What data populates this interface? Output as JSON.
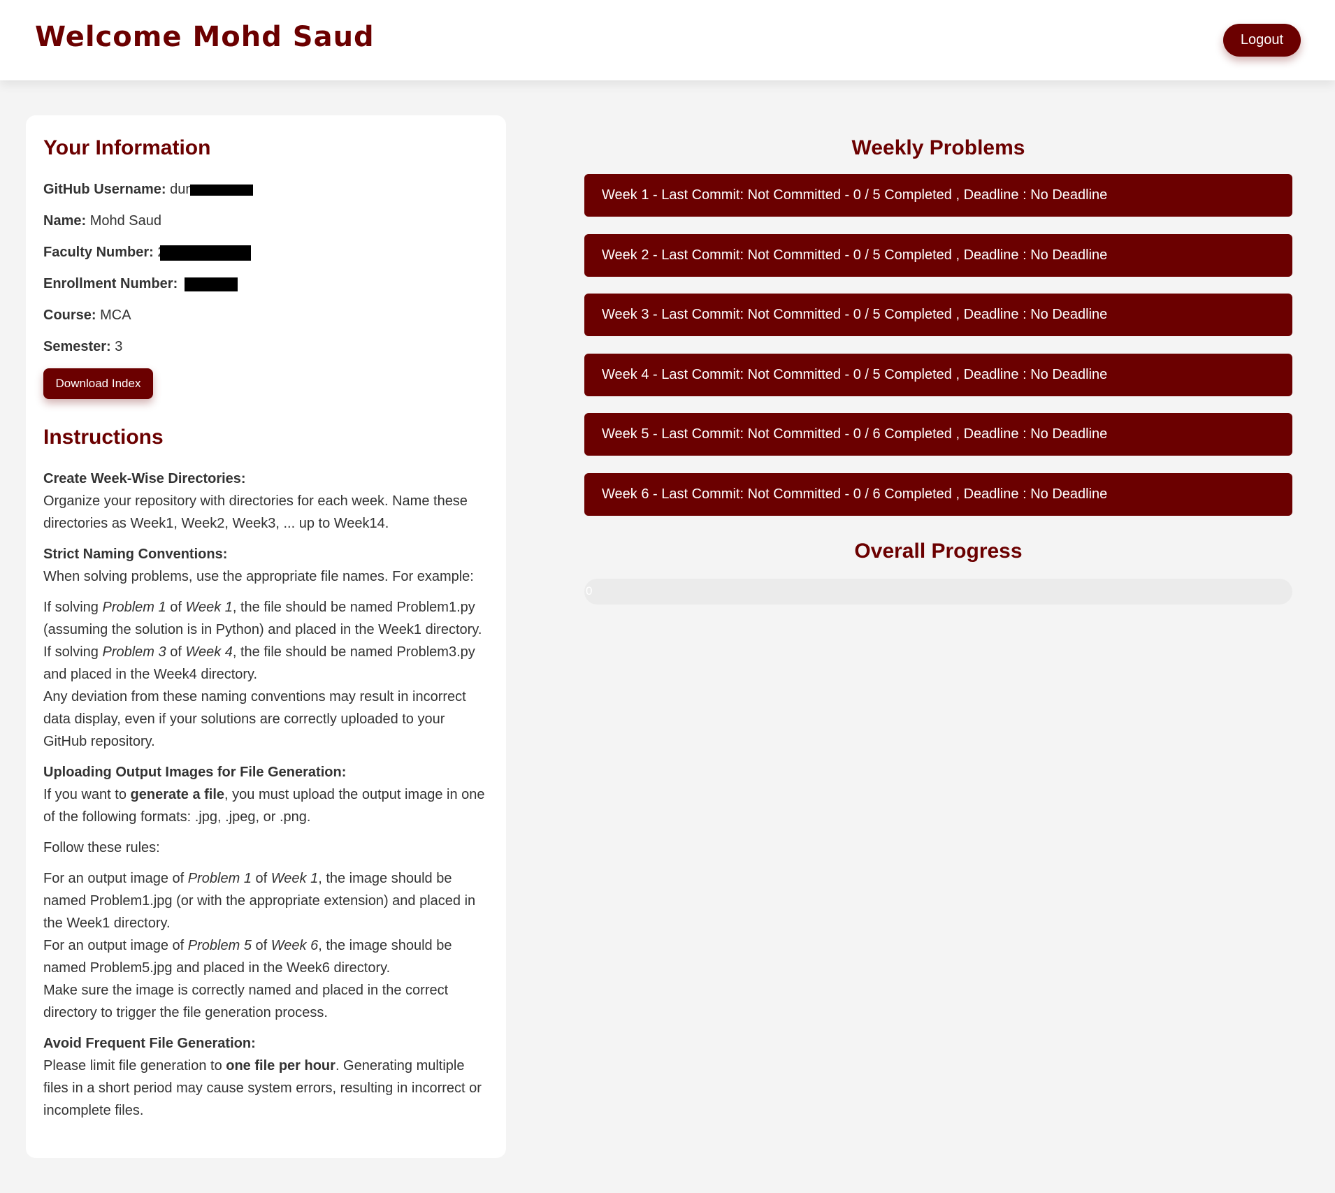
{
  "header": {
    "welcome": "Welcome Mohd Saud",
    "logout_label": "Logout"
  },
  "info": {
    "title": "Your Information",
    "github_label": "GitHub Username:",
    "github_value": "dum",
    "name_label": "Name:",
    "name_value": "Mohd Saud",
    "faculty_label": "Faculty Number:",
    "faculty_value": "2",
    "enrollment_label": "Enrollment Number:",
    "course_label": "Course:",
    "course_value": "MCA",
    "semester_label": "Semester:",
    "semester_value": "3",
    "download_label": "Download Index"
  },
  "instructions": {
    "title": "Instructions",
    "s1_head": "Create Week-Wise Directories:",
    "s1_text": "Organize your repository with directories for each week. Name these directories as Week1, Week2, Week3, ... up to Week14.",
    "s2_head": "Strict Naming Conventions:",
    "s2_text": "When solving problems, use the appropriate file names. For example:",
    "s2_ex1_a": "If solving ",
    "s2_ex1_p": "Problem 1",
    "s2_ex1_of": " of ",
    "s2_ex1_w": "Week 1",
    "s2_ex1_b": ", the file should be named Problem1.py (assuming the solution is in Python) and placed in the Week1 directory.",
    "s2_ex2_a": "If solving ",
    "s2_ex2_p": "Problem 3",
    "s2_ex2_of": " of ",
    "s2_ex2_w": "Week 4",
    "s2_ex2_b": ", the file should be named Problem3.py and placed in the Week4 directory.",
    "s2_warn": "Any deviation from these naming conventions may result in incorrect data display, even if your solutions are correctly uploaded to your GitHub repository.",
    "s3_head": "Uploading Output Images for File Generation:",
    "s3_text_a": "If you want to ",
    "s3_text_bold": "generate a file",
    "s3_text_b": ", you must upload the output image in one of the following formats: .jpg, .jpeg, or .png.",
    "s3_rules": "Follow these rules:",
    "s3_r1_a": "For an output image of ",
    "s3_r1_p": "Problem 1",
    "s3_r1_of": " of ",
    "s3_r1_w": "Week 1",
    "s3_r1_b": ", the image should be named Problem1.jpg (or with the appropriate extension) and placed in the Week1 directory.",
    "s3_r2_a": "For an output image of ",
    "s3_r2_p": "Problem 5",
    "s3_r2_of": " of ",
    "s3_r2_w": "Week 6",
    "s3_r2_b": ", the image should be named Problem5.jpg and placed in the Week6 directory.",
    "s3_r3": "Make sure the image is correctly named and placed in the correct directory to trigger the file generation process.",
    "s4_head": "Avoid Frequent File Generation:",
    "s4_text_a": "Please limit file generation to ",
    "s4_text_bold": "one file per hour",
    "s4_text_b": ". Generating multiple files in a short period may cause system errors, resulting in incorrect or incomplete files."
  },
  "weekly": {
    "title": "Weekly Problems",
    "weeks": [
      "Week 1 - Last Commit: Not Committed - 0 / 5 Completed , Deadline : No Deadline",
      "Week 2 - Last Commit: Not Committed - 0 / 5 Completed , Deadline : No Deadline",
      "Week 3 - Last Commit: Not Committed - 0 / 5 Completed , Deadline : No Deadline",
      "Week 4 - Last Commit: Not Committed - 0 / 5 Completed , Deadline : No Deadline",
      "Week 5 - Last Commit: Not Committed - 0 / 6 Completed , Deadline : No Deadline",
      "Week 6 - Last Commit: Not Committed - 0 / 6 Completed , Deadline : No Deadline"
    ]
  },
  "progress": {
    "title": "Overall Progress",
    "value": 0,
    "label": "0"
  },
  "colors": {
    "accent": "#6b0000",
    "background": "#f4f4f4"
  }
}
